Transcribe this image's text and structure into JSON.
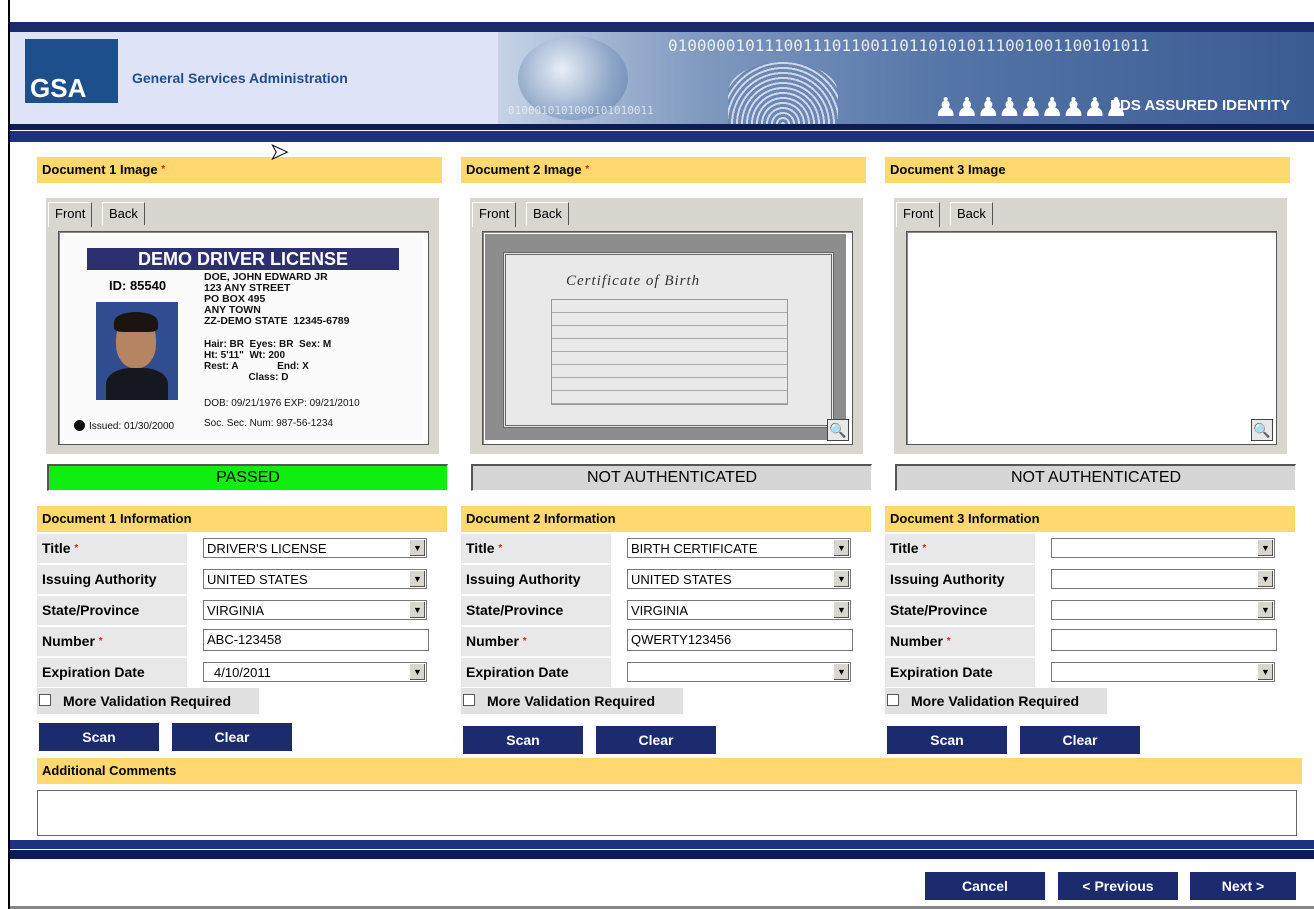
{
  "header": {
    "logo_text": "GSA",
    "agency": "General Services Administration",
    "banner_title": "EDS ASSURED IDENTITY",
    "banner_bits": "01000001011100111011001101101010111001001100101011",
    "banner_bits_small": "0100010101000101010011"
  },
  "tabs": {
    "front": "Front",
    "back": "Back"
  },
  "documents": [
    {
      "image_header": "Document 1 Image",
      "required": "*",
      "status": "PASSED",
      "info_header": "Document 1 Information",
      "fields": {
        "title": "DRIVER'S LICENSE",
        "issuing_authority": "UNITED STATES",
        "state_province": "VIRGINIA",
        "number": "ABC-123458",
        "expiration_date": "4/10/2011"
      }
    },
    {
      "image_header": "Document 2 Image",
      "required": "*",
      "status": "NOT AUTHENTICATED",
      "info_header": "Document 2 Information",
      "fields": {
        "title": "BIRTH CERTIFICATE",
        "issuing_authority": "UNITED STATES",
        "state_province": "VIRGINIA",
        "number": "QWERTY123456",
        "expiration_date": ""
      }
    },
    {
      "image_header": "Document 3 Image",
      "required": "",
      "status": "NOT AUTHENTICATED",
      "info_header": "Document 3 Information",
      "fields": {
        "title": "",
        "issuing_authority": "",
        "state_province": "",
        "number": "",
        "expiration_date": ""
      }
    }
  ],
  "labels": {
    "title": "Title",
    "issuing_authority": "Issuing Authority",
    "state_province": "State/Province",
    "number": "Number",
    "expiration_date": "Expiration Date",
    "required": "*",
    "more_validation": "More Validation Required",
    "scan": "Scan",
    "clear": "Clear",
    "additional_comments": "Additional Comments"
  },
  "license": {
    "heading": "DEMO DRIVER LICENSE",
    "id": "ID: 85540",
    "address": "DOE, JOHN EDWARD JR\n123 ANY STREET\nPO BOX 495\nANY TOWN\nZZ-DEMO STATE  12345-6789",
    "physical": "Hair: BR  Eyes: BR  Sex: M\nHt: 5'11\"  Wt: 200\nRest: A              End: X\n                Class: D",
    "dob_exp": "DOB: 09/21/1976 EXP: 09/21/2010",
    "issued": "Issued: 01/30/2000",
    "ssn": "Soc. Sec. Num: 987-56-1234"
  },
  "certificate": {
    "heading": "Certificate of Birth"
  },
  "footer": {
    "cancel": "Cancel",
    "previous": "< Previous",
    "next": "Next >"
  },
  "colors": {
    "section_header": "#ffd96f",
    "button": "#1b2b6e",
    "passed": "#10ee10",
    "not_authenticated": "#d6d6d6"
  },
  "icons": {
    "zoom": "magnifier-icon",
    "dropdown": "chevron-down-icon",
    "cursor": "mouse-pointer-icon"
  }
}
